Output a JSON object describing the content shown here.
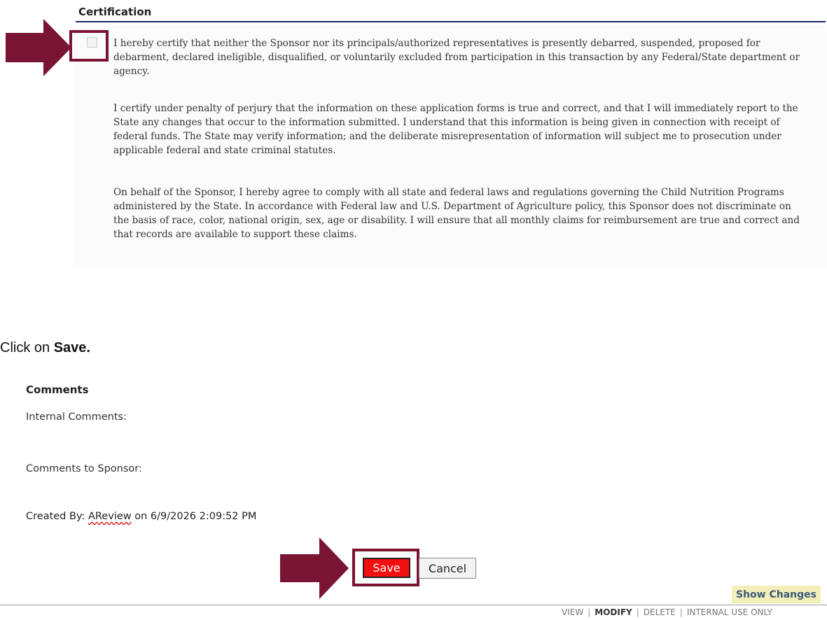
{
  "certification": {
    "title": "Certification",
    "paragraphs": [
      "I hereby certify that neither the Sponsor nor its principals/authorized representatives is presently debarred, suspended, proposed for debarment, declared ineligible, disqualified, or voluntarily excluded from participation in this transaction by any Federal/State department or agency.",
      "I certify under penalty of perjury that the information on these application forms is true and correct, and that I will immediately report to the State any changes that occur to the information submitted. I understand that this information is being given in connection with receipt of federal funds. The State may verify information; and the deliberate misrepresentation of information will subject me to prosecution under applicable federal and state criminal statutes.",
      "On behalf of the Sponsor, I hereby agree to comply with all state and federal laws and regulations governing the Child Nutrition Programs administered by the State. In accordance with Federal law and U.S. Department of Agriculture policy, this Sponsor does not discriminate on the basis of race, color, national origin, sex, age or disability. I will ensure that all monthly claims for reimbursement are true and correct and that records are available to support these claims."
    ],
    "checkbox_checked": false
  },
  "instruction": {
    "prefix": "Click on ",
    "bold": "Save."
  },
  "comments": {
    "title": "Comments",
    "internal_label": "Internal Comments:",
    "sponsor_label": "Comments to Sponsor:",
    "created_prefix": "Created By: ",
    "created_user": "AReview",
    "created_suffix": " on 6/9/2026 2:09:52 PM"
  },
  "buttons": {
    "save": "Save",
    "cancel": "Cancel",
    "show_changes": "Show Changes"
  },
  "footer": {
    "view": "VIEW",
    "modify": "MODIFY",
    "delete": "DELETE",
    "internal_use": "INTERNAL USE ONLY",
    "separator": "|"
  },
  "colors": {
    "highlight": "#7a1433",
    "save_bg": "#f20f0f",
    "rule": "#1f2a6e",
    "show_changes_bg": "#f4efb8"
  },
  "icons": {
    "pointer_arrow": "right-arrow-icon"
  }
}
